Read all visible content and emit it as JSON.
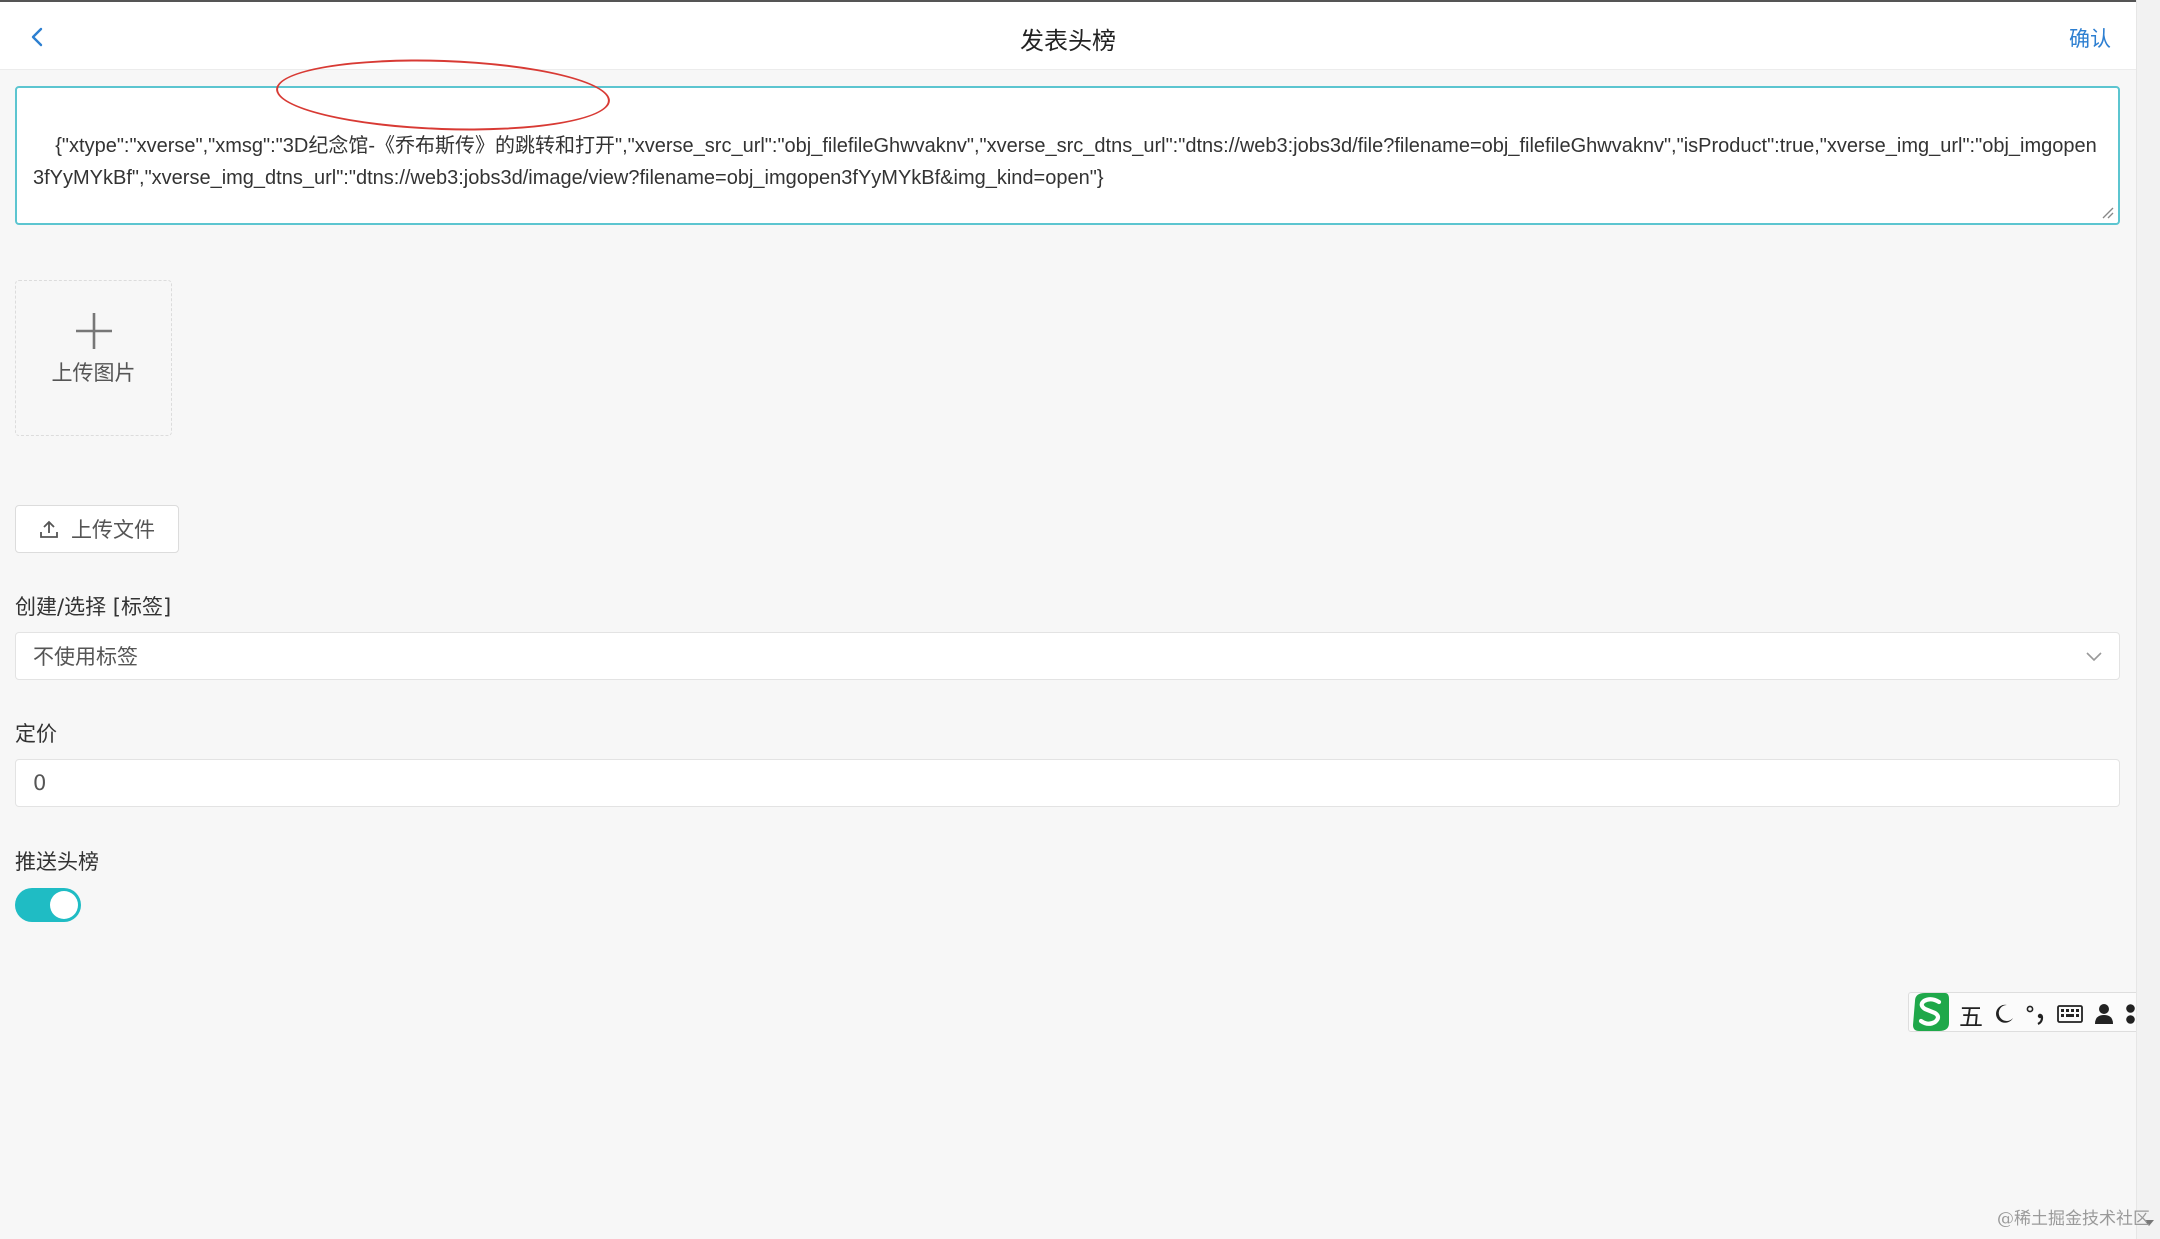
{
  "header": {
    "title": "发表头榜",
    "confirm_label": "确认"
  },
  "editor": {
    "json_text": "{\"xtype\":\"xverse\",\"xmsg\":\"3D纪念馆-《乔布斯传》的跳转和打开\",\"xverse_src_url\":\"obj_filefileGhwvaknv\",\"xverse_src_dtns_url\":\"dtns://web3:jobs3d/file?filename=obj_filefileGhwvaknv\",\"isProduct\":true,\"xverse_img_url\":\"obj_imgopen3fYyMYkBf\",\"xverse_img_dtns_url\":\"dtns://web3:jobs3d/image/view?filename=obj_imgopen3fYyMYkBf&img_kind=open\"}",
    "annotation_color": "#d83a34"
  },
  "upload_image": {
    "label": "上传图片",
    "icon": "plus-icon"
  },
  "upload_file": {
    "label": "上传文件",
    "icon": "upload-icon"
  },
  "tags": {
    "label": "创建/选择 [标签]",
    "selected": "不使用标签",
    "icon": "chevron-down-icon"
  },
  "price": {
    "label": "定价",
    "value": "0"
  },
  "push": {
    "label": "推送头榜",
    "enabled": true,
    "accent_color": "#1fbcc4"
  },
  "ime": {
    "mode_char": "五"
  },
  "watermark": "@稀土掘金技术社区",
  "colors": {
    "accent": "#1fbcc4",
    "link": "#2d7fd1",
    "input_focus_border": "#5cc5d0"
  }
}
